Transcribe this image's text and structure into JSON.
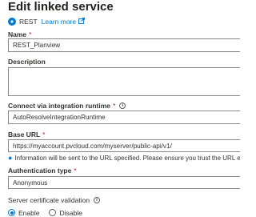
{
  "header": {
    "title": "Edit linked service",
    "service_type": "REST",
    "learn_more": "Learn more"
  },
  "form": {
    "name": {
      "label": "Name",
      "required": "*",
      "value": "REST_Planview"
    },
    "description": {
      "label": "Description",
      "value": ""
    },
    "runtime": {
      "label": "Connect via integration runtime",
      "required": "*",
      "value": "AutoResolveIntegrationRuntime"
    },
    "base_url": {
      "label": "Base URL",
      "required": "*",
      "value": "https://myaccount.pvcloud.com/myserver/public-api/v1/",
      "notice": "Information will be sent to the URL specified. Please ensure you trust the URL entered"
    },
    "auth": {
      "label": "Authentication type",
      "required": "*",
      "value": "Anonymous"
    },
    "cert": {
      "label": "Server certificate validation",
      "options": [
        "Enable",
        "Disable"
      ],
      "selected": "Enable"
    }
  },
  "colors": {
    "accent": "#0078d4",
    "required": "#a4262c",
    "border": "#8a8886"
  },
  "icons": [
    "rest-icon",
    "external-link-icon",
    "info-icon",
    "info-circle-icon"
  ]
}
